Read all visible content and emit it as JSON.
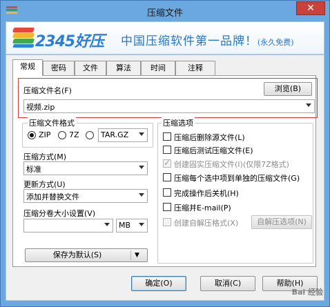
{
  "window": {
    "title": "压缩文件",
    "close": "✕"
  },
  "banner": {
    "logo": "2345好压",
    "slogan": "中国压缩软件第一品牌！",
    "slogan_note": "(永久免费)"
  },
  "tabs": [
    "常规",
    "密码",
    "文件",
    "算法",
    "时间",
    "注释"
  ],
  "archive_name": {
    "label": "压缩文件名(F)",
    "browse": "浏览(B)",
    "value": "视频.zip"
  },
  "format": {
    "title": "压缩文件格式",
    "options": [
      "ZIP",
      "7Z"
    ],
    "selected": "ZIP",
    "other_combo": "TAR.GZ"
  },
  "method": {
    "label": "压缩方式(M)",
    "value": "标准"
  },
  "update": {
    "label": "更新方式(U)",
    "value": "添加并替换文件"
  },
  "volume": {
    "label": "压缩分卷大小设置(V)",
    "value": "",
    "unit": "MB"
  },
  "save_default": "保存为默认(S)",
  "options": {
    "title": "压缩选项",
    "items": [
      {
        "label": "压缩后删除源文件(L)",
        "checked": false,
        "disabled": false
      },
      {
        "label": "压缩后测试压缩文件(E)",
        "checked": false,
        "disabled": false
      },
      {
        "label": "创建固实压缩文件(I)(仅限7Z格式)",
        "checked": true,
        "disabled": true
      },
      {
        "label": "压缩每个选中项到单独的压缩文件(G)",
        "checked": false,
        "disabled": false
      },
      {
        "label": "完成操作后关机(H)",
        "checked": false,
        "disabled": false
      },
      {
        "label": "压缩并E-mail(P)",
        "checked": false,
        "disabled": false
      },
      {
        "label": "创建自解压格式(X)",
        "checked": false,
        "disabled": true
      }
    ],
    "sfx_button": "自解压选项(N)"
  },
  "footer": {
    "ok": "确定(O)",
    "cancel": "取消(C)",
    "help": "帮助(H)"
  },
  "watermark": "Bai 经验"
}
